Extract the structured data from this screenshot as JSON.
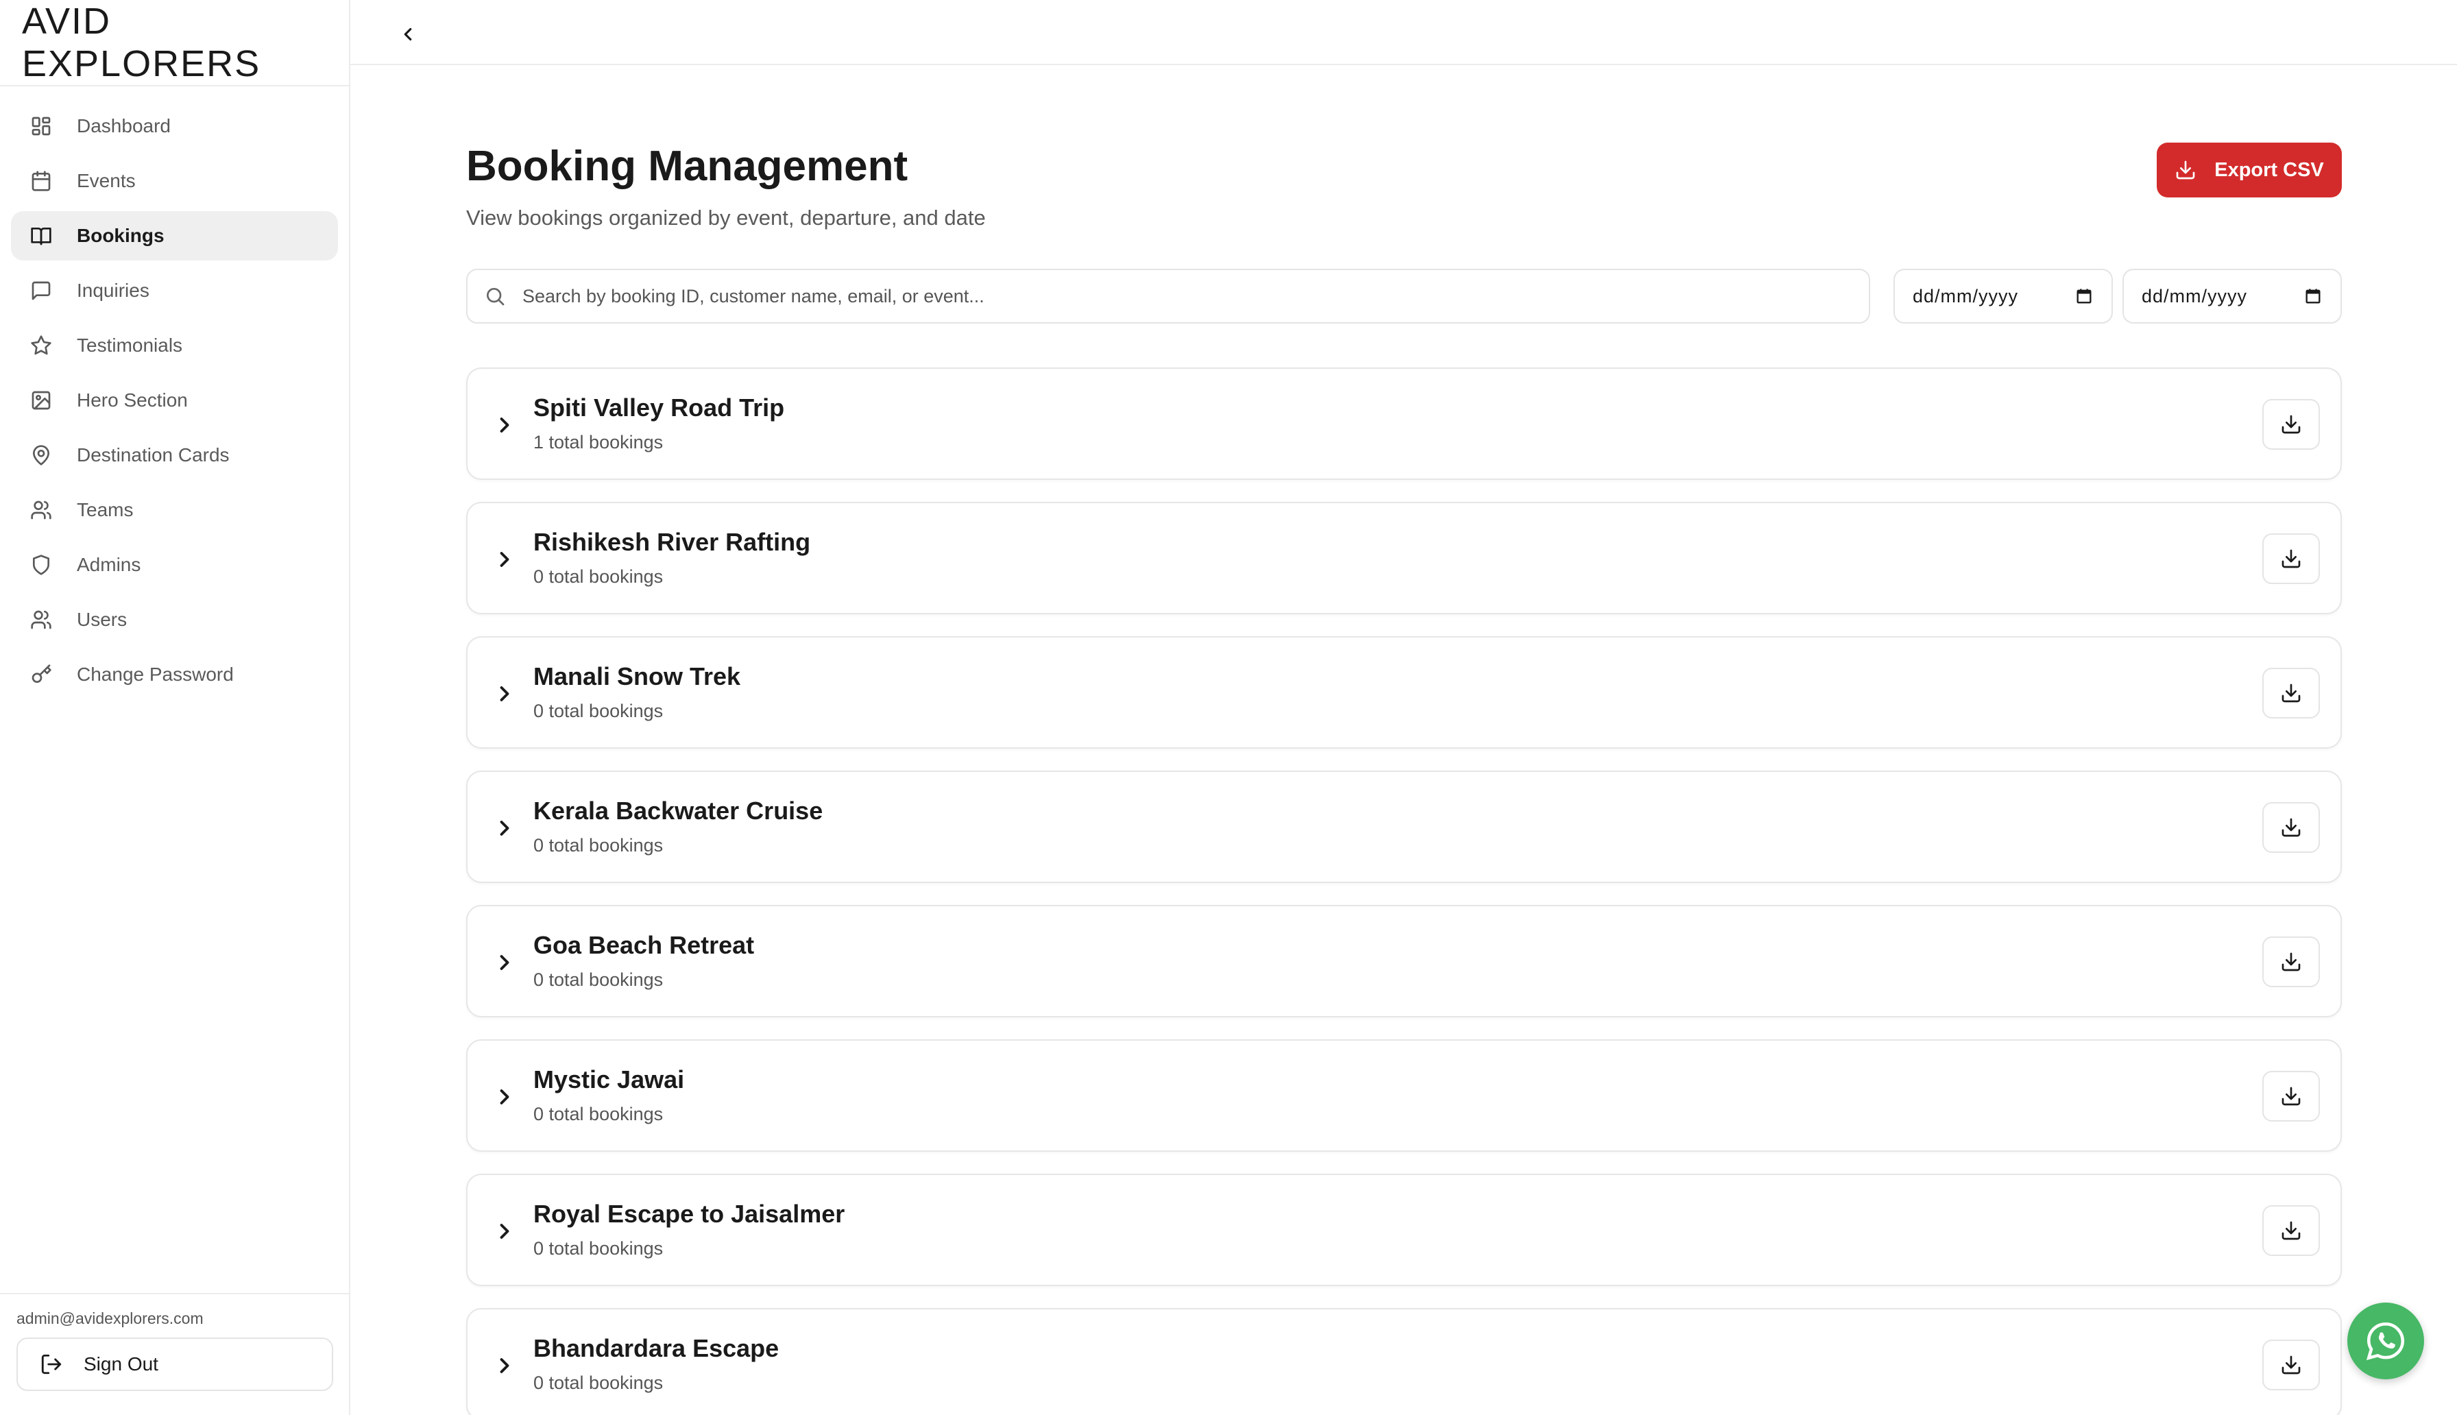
{
  "brand": {
    "logo_text": "AVID EXPLORERS"
  },
  "sidebar": {
    "items": [
      {
        "label": "Dashboard",
        "icon": "dashboard-icon"
      },
      {
        "label": "Events",
        "icon": "calendar-icon"
      },
      {
        "label": "Bookings",
        "icon": "book-icon",
        "active": true
      },
      {
        "label": "Inquiries",
        "icon": "message-icon"
      },
      {
        "label": "Testimonials",
        "icon": "star-icon"
      },
      {
        "label": "Hero Section",
        "icon": "image-icon"
      },
      {
        "label": "Destination Cards",
        "icon": "map-pin-icon"
      },
      {
        "label": "Teams",
        "icon": "users-icon"
      },
      {
        "label": "Admins",
        "icon": "shield-icon"
      },
      {
        "label": "Users",
        "icon": "users-icon"
      },
      {
        "label": "Change Password",
        "icon": "key-icon"
      }
    ],
    "footer": {
      "email": "admin@avidexplorers.com",
      "sign_out_label": "Sign Out"
    }
  },
  "header": {
    "title": "Booking Management",
    "subtitle": "View bookings organized by event, departure, and date",
    "export_label": "Export CSV"
  },
  "filters": {
    "search_placeholder": "Search by booking ID, customer name, email, or event...",
    "date_from": "dd/mm/yyyy",
    "date_to": "dd/mm/yyyy"
  },
  "events": [
    {
      "name": "Spiti Valley Road Trip",
      "count": "1 total bookings"
    },
    {
      "name": "Rishikesh River Rafting",
      "count": "0 total bookings"
    },
    {
      "name": "Manali Snow Trek",
      "count": "0 total bookings"
    },
    {
      "name": "Kerala Backwater Cruise",
      "count": "0 total bookings"
    },
    {
      "name": "Goa Beach Retreat",
      "count": "0 total bookings"
    },
    {
      "name": "Mystic Jawai",
      "count": "0 total bookings"
    },
    {
      "name": "Royal Escape to Jaisalmer",
      "count": "0 total bookings"
    },
    {
      "name": "Bhandardara Escape",
      "count": "0 total bookings"
    }
  ],
  "colors": {
    "accent": "#d32b2b",
    "active_bg": "#efefef",
    "whatsapp": "#47b866"
  }
}
